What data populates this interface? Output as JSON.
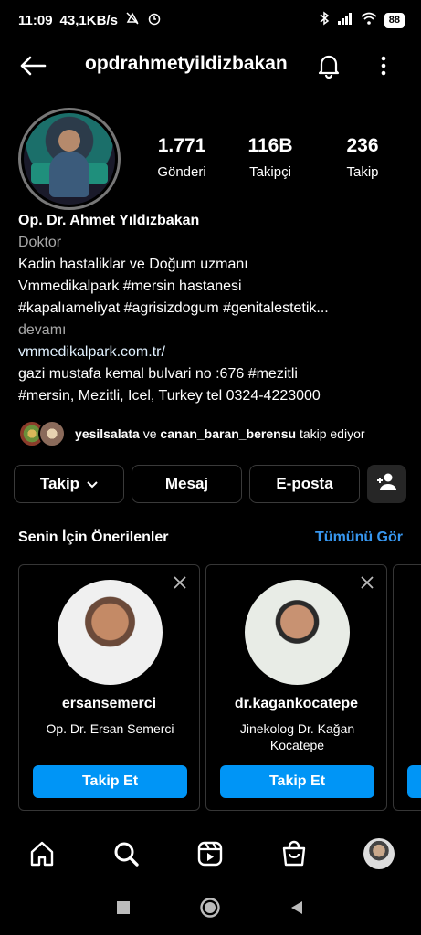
{
  "status_bar": {
    "time": "11:09",
    "speed": "43,1KB/s",
    "battery": "88"
  },
  "header": {
    "username": "opdrahmetyildizbakan"
  },
  "stats": [
    {
      "value": "1.771",
      "label": "Gönderi"
    },
    {
      "value": "116B",
      "label": "Takipçi"
    },
    {
      "value": "236",
      "label": "Takip"
    }
  ],
  "bio": {
    "name": "Op. Dr. Ahmet Yıldızbakan",
    "category": "Doktor",
    "line1": "Kadin hastaliklar ve Doğum uzmanı",
    "line2": "Vmmedikalpark #mersin hastanesi",
    "line3": "#kapalıameliyat #agrisizdogum #genitalestetik...",
    "more": "devamı",
    "link": "vmmedikalpark.com.tr/",
    "address1": "gazi mustafa kemal bulvari no :676 #mezitli",
    "address2": "#mersin, Mezitli, Icel, Turkey tel  0324-4223000"
  },
  "followed_by": {
    "user1": "yesilsalata",
    "connector": "ve",
    "user2": "canan_baran_berensu",
    "suffix": "takip ediyor"
  },
  "actions": {
    "follow": "Takip",
    "message": "Mesaj",
    "email": "E-posta"
  },
  "suggestions": {
    "title": "Senin İçin Önerilenler",
    "see_all": "Tümünü Gör",
    "cards": [
      {
        "username": "ersansemerci",
        "subtitle": "Op. Dr. Ersan Semerci",
        "button": "Takip Et"
      },
      {
        "username": "dr.kagankocatepe",
        "subtitle": "Jinekolog Dr. Kağan Kocatepe",
        "button": "Takip Et"
      }
    ]
  },
  "colors": {
    "accent": "#0095f6",
    "link": "#3797f0"
  }
}
